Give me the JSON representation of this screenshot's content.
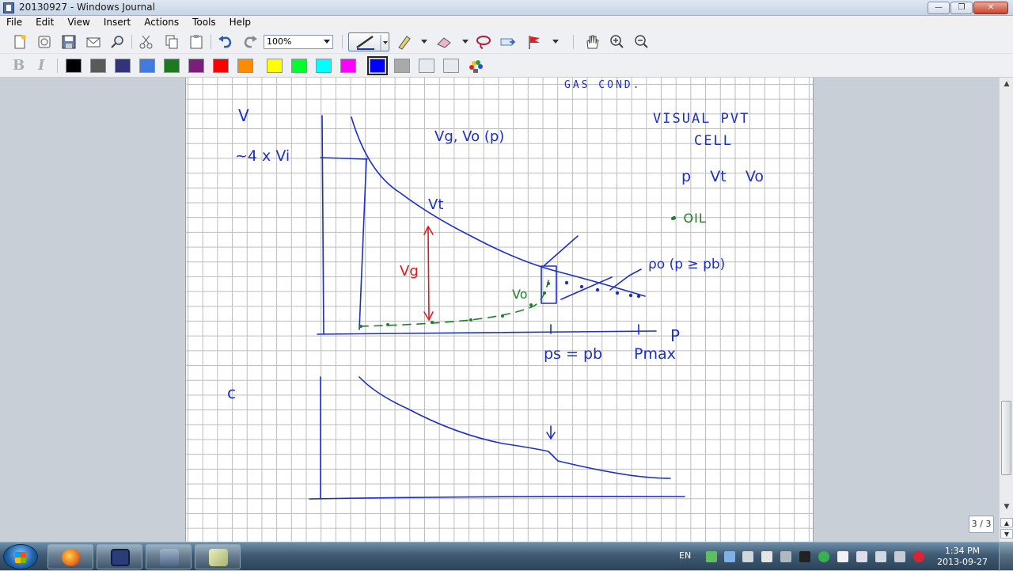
{
  "window": {
    "title": "20130927 - Windows Journal",
    "buttons": {
      "minimize": "—",
      "maximize": "❐",
      "close": "✕"
    }
  },
  "menu": [
    "File",
    "Edit",
    "View",
    "Insert",
    "Actions",
    "Tools",
    "Help"
  ],
  "toolbar": {
    "zoom_value": "100%",
    "icons": [
      "new-note-icon",
      "open-icon",
      "save-icon",
      "email-icon",
      "find-icon",
      "cut-icon",
      "copy-icon",
      "paste-icon",
      "undo-icon",
      "redo-icon",
      "pen-icon",
      "highlighter-icon",
      "eraser-icon",
      "lasso-icon",
      "insert-space-icon",
      "flag-icon",
      "hand-pan-icon",
      "zoom-in-icon",
      "zoom-out-icon"
    ]
  },
  "format_toolbar": {
    "bold": "B",
    "italic": "I",
    "colors": [
      "#000000",
      "#5a5a5a",
      "#33337a",
      "#3f7be0",
      "#1e7a1e",
      "#7a1e7a",
      "#ff0000",
      "#ff8c00",
      "#ffff00",
      "#00ff2a",
      "#00ffff",
      "#ff00ff",
      "#0000ff",
      "#a9a9a9",
      "#e6e9ed",
      "#e6e9ed"
    ],
    "selected_color": "#0000ff",
    "color_icon": "color-palette-icon"
  },
  "journal": {
    "ink_blue": "#1c2fc8",
    "ink_red": "#e0191c",
    "ink_green": "#1e7f2a",
    "annotations": {
      "top_note": "GAS COND.",
      "axis_v": "V",
      "vi_label": "~4 x Vi",
      "vg_vo_label": "Vg, Vo (p)",
      "vt_label": "Vt",
      "vg_label": "Vg",
      "vo_label": "Vo",
      "rho_label": "ρo (p ≥ pb)",
      "axis_p": "P",
      "ps_pb_label": "ps = pb",
      "pmax_label": "Pmax",
      "visual_pvt": "VISUAL PVT",
      "cell": "CELL",
      "p_vt_vo": "p    Vt    Vo",
      "oil": "• OIL",
      "c_label": "c"
    }
  },
  "page_indicator": "3 / 3",
  "taskbar": {
    "apps": [
      "firefox-icon",
      "floppy-icon",
      "pc-icon",
      "notes-icon"
    ],
    "lang": "EN",
    "time": "1:34 PM",
    "date": "2013-09-27"
  }
}
